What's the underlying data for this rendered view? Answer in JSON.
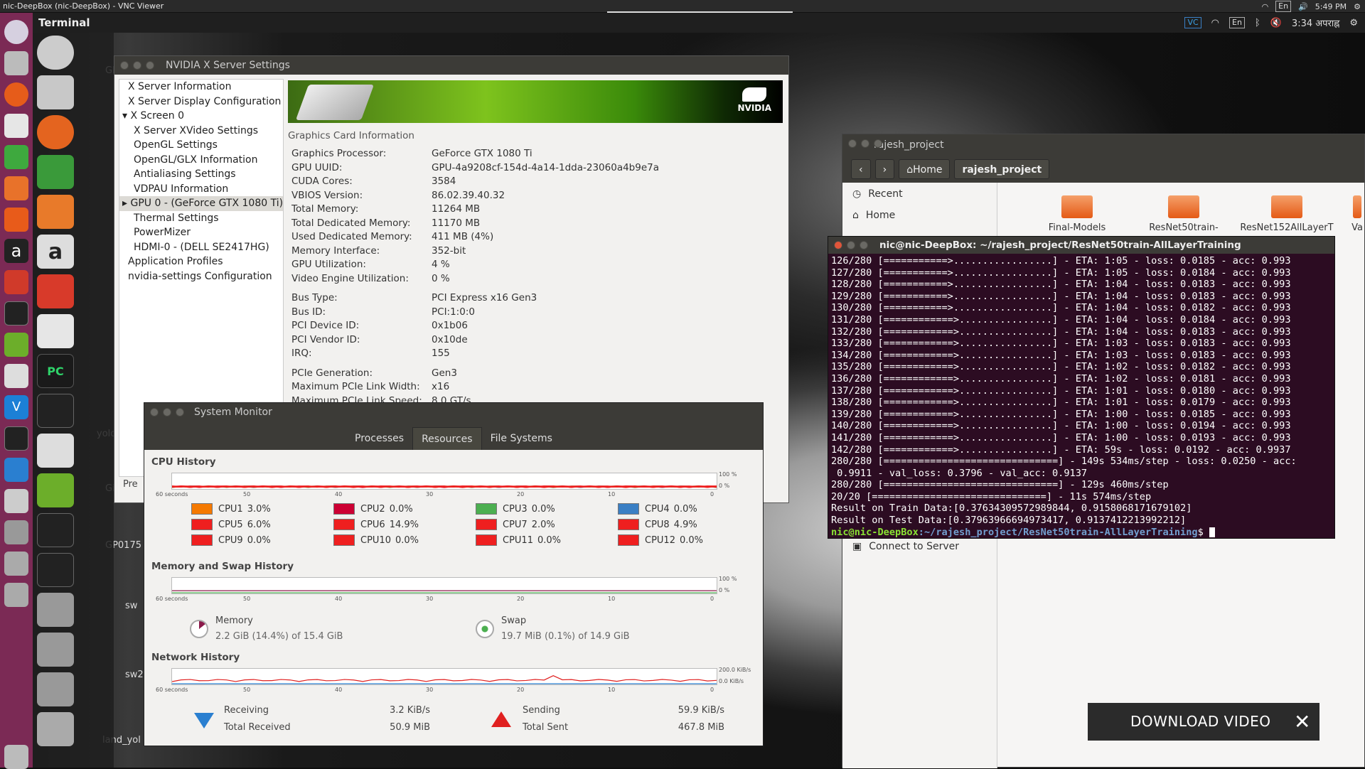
{
  "vnc": {
    "title": "nic-DeepBox (nic-DeepBox) - VNC Viewer",
    "time": "5:49 PM",
    "lang": "En"
  },
  "topbar": {
    "app_name": "Terminal",
    "lang": "En",
    "time": "3:34 अपराह्न",
    "vc": "VC"
  },
  "desktop": {
    "labels": [
      "Gl",
      "Gi",
      "yolo",
      "GP0175",
      "sw",
      "sw2",
      "land_yol"
    ]
  },
  "nvidia": {
    "title": "NVIDIA X Server Settings",
    "tree": [
      {
        "label": "X Server Information",
        "indent": 1
      },
      {
        "label": "X Server Display Configuration",
        "indent": 1
      },
      {
        "label": "▾ X Screen 0",
        "indent": 0
      },
      {
        "label": "X Server XVideo Settings",
        "indent": 2
      },
      {
        "label": "OpenGL Settings",
        "indent": 2
      },
      {
        "label": "OpenGL/GLX Information",
        "indent": 2
      },
      {
        "label": "Antialiasing Settings",
        "indent": 2
      },
      {
        "label": "VDPAU Information",
        "indent": 2
      },
      {
        "label": "▸ GPU 0 - (GeForce GTX 1080 Ti)",
        "indent": 0,
        "selected": true
      },
      {
        "label": "Thermal Settings",
        "indent": 2
      },
      {
        "label": "PowerMizer",
        "indent": 2
      },
      {
        "label": "HDMI-0 - (DELL SE2417HG)",
        "indent": 2
      },
      {
        "label": "Application Profiles",
        "indent": 1
      },
      {
        "label": "nvidia-settings Configuration",
        "indent": 1
      }
    ],
    "logo_text": "NVIDIA",
    "section_title": "Graphics Card Information",
    "group1": [
      [
        "Graphics Processor:",
        "GeForce GTX 1080 Ti"
      ],
      [
        "GPU UUID:",
        "GPU-4a9208cf-154d-4a14-1dda-23060a4b9e7a"
      ],
      [
        "CUDA Cores:",
        "3584"
      ],
      [
        "VBIOS Version:",
        "86.02.39.40.32"
      ],
      [
        "Total Memory:",
        "11264 MB"
      ],
      [
        "Total Dedicated Memory:",
        "11170 MB"
      ],
      [
        "Used Dedicated Memory:",
        "411 MB (4%)"
      ],
      [
        "Memory Interface:",
        "352-bit"
      ],
      [
        "GPU Utilization:",
        "4 %"
      ],
      [
        "Video Engine Utilization:",
        "0 %"
      ]
    ],
    "group2": [
      [
        "Bus Type:",
        "PCI Express x16 Gen3"
      ],
      [
        "Bus ID:",
        "PCI:1:0:0"
      ],
      [
        "PCI Device ID:",
        "0x1b06"
      ],
      [
        "PCI Vendor ID:",
        "0x10de"
      ],
      [
        "IRQ:",
        "155"
      ]
    ],
    "group3": [
      [
        "PCIe Generation:",
        "Gen3"
      ],
      [
        "Maximum PCIe Link Width:",
        "x16"
      ],
      [
        "Maximum PCIe Link Speed:",
        "8.0 GT/s"
      ]
    ],
    "footer_button": "Pre"
  },
  "sysmon": {
    "title": "System Monitor",
    "tabs": [
      "Processes",
      "Resources",
      "File Systems"
    ],
    "active_tab": "Resources",
    "cpu_title": "CPU History",
    "mem_title": "Memory and Swap History",
    "net_title": "Network History",
    "axis_ticks": [
      "60 seconds",
      "50",
      "40",
      "30",
      "20",
      "10",
      "0"
    ],
    "pct_top": "100 %",
    "pct_bottom": "0 %",
    "net_top": "200.0 KiB/s",
    "net_bottom": "0.0 KiB/s",
    "cpus": [
      {
        "label": "CPU1",
        "value": "3.0%",
        "color": "#f57900"
      },
      {
        "label": "CPU2",
        "value": "0.0%",
        "color": "#cc0033"
      },
      {
        "label": "CPU3",
        "value": "0.0%",
        "color": "#4caf50"
      },
      {
        "label": "CPU4",
        "value": "0.0%",
        "color": "#3a7fc4"
      },
      {
        "label": "CPU5",
        "value": "6.0%",
        "color": "#ef1f1f"
      },
      {
        "label": "CPU6",
        "value": "14.9%",
        "color": "#ef1f1f"
      },
      {
        "label": "CPU7",
        "value": "2.0%",
        "color": "#ef1f1f"
      },
      {
        "label": "CPU8",
        "value": "4.9%",
        "color": "#ef1f1f"
      },
      {
        "label": "CPU9",
        "value": "0.0%",
        "color": "#ef1f1f"
      },
      {
        "label": "CPU10",
        "value": "0.0%",
        "color": "#ef1f1f"
      },
      {
        "label": "CPU11",
        "value": "0.0%",
        "color": "#ef1f1f"
      },
      {
        "label": "CPU12",
        "value": "0.0%",
        "color": "#ef1f1f"
      }
    ],
    "memory": {
      "label": "Memory",
      "value": "2.2 GiB (14.4%) of 15.4 GiB",
      "fraction": 0.144
    },
    "swap": {
      "label": "Swap",
      "value": "19.7 MiB (0.1%) of 14.9 GiB",
      "fraction": 0.001
    },
    "net": {
      "receiving_label": "Receiving",
      "receiving": "3.2 KiB/s",
      "total_received_label": "Total Received",
      "total_received": "50.9 MiB",
      "sending_label": "Sending",
      "sending": "59.9 KiB/s",
      "total_sent_label": "Total Sent",
      "total_sent": "467.8 MiB"
    }
  },
  "files": {
    "title": "rajesh_project",
    "crumbs": [
      "Home",
      "rajesh_project"
    ],
    "sidebar": [
      "Recent",
      "Home",
      "Connect to Server"
    ],
    "folders": [
      "Final-Models",
      "ResNet50train-",
      "ResNet152AllLayerT",
      "Va"
    ]
  },
  "terminal": {
    "title": "nic@nic-DeepBox: ~/rajesh_project/ResNet50train-AllLayerTraining",
    "lines": [
      "126/280 [===========>.................] - ETA: 1:05 - loss: 0.0185 - acc: 0.993",
      "127/280 [===========>.................] - ETA: 1:05 - loss: 0.0184 - acc: 0.993",
      "128/280 [===========>.................] - ETA: 1:04 - loss: 0.0183 - acc: 0.993",
      "129/280 [===========>.................] - ETA: 1:04 - loss: 0.0183 - acc: 0.993",
      "130/280 [===========>.................] - ETA: 1:04 - loss: 0.0182 - acc: 0.993",
      "131/280 [============>................] - ETA: 1:04 - loss: 0.0184 - acc: 0.993",
      "132/280 [============>................] - ETA: 1:04 - loss: 0.0183 - acc: 0.993",
      "133/280 [============>................] - ETA: 1:03 - loss: 0.0183 - acc: 0.993",
      "134/280 [============>................] - ETA: 1:03 - loss: 0.0183 - acc: 0.993",
      "135/280 [============>................] - ETA: 1:02 - loss: 0.0182 - acc: 0.993",
      "136/280 [============>................] - ETA: 1:02 - loss: 0.0181 - acc: 0.993",
      "137/280 [============>................] - ETA: 1:01 - loss: 0.0180 - acc: 0.993",
      "138/280 [============>................] - ETA: 1:01 - loss: 0.0179 - acc: 0.993",
      "139/280 [============>................] - ETA: 1:00 - loss: 0.0185 - acc: 0.993",
      "140/280 [============>................] - ETA: 1:00 - loss: 0.0194 - acc: 0.993",
      "141/280 [============>................] - ETA: 1:00 - loss: 0.0193 - acc: 0.993",
      "142/280 [============>................] - ETA: 59s - loss: 0.0192 - acc: 0.9937",
      "280/280 [==============================] - 149s 534ms/step - loss: 0.0250 - acc:",
      " 0.9911 - val_loss: 0.3796 - val_acc: 0.9137",
      "280/280 [==============================] - 129s 460ms/step",
      "20/20 [==============================] - 11s 574ms/step",
      "Result on Train Data:[0.37634309572989844, 0.9158068171679102]",
      "Result on Test Data:[0.37963966694973417, 0.9137412213992212]"
    ],
    "prompt_user": "nic@nic-DeepBox",
    "prompt_path": ":~/rajesh_project/ResNet50train-AllLayerTraining",
    "prompt_symbol": "$ "
  },
  "download": {
    "label": "DOWNLOAD VIDEO",
    "close": "✕"
  }
}
